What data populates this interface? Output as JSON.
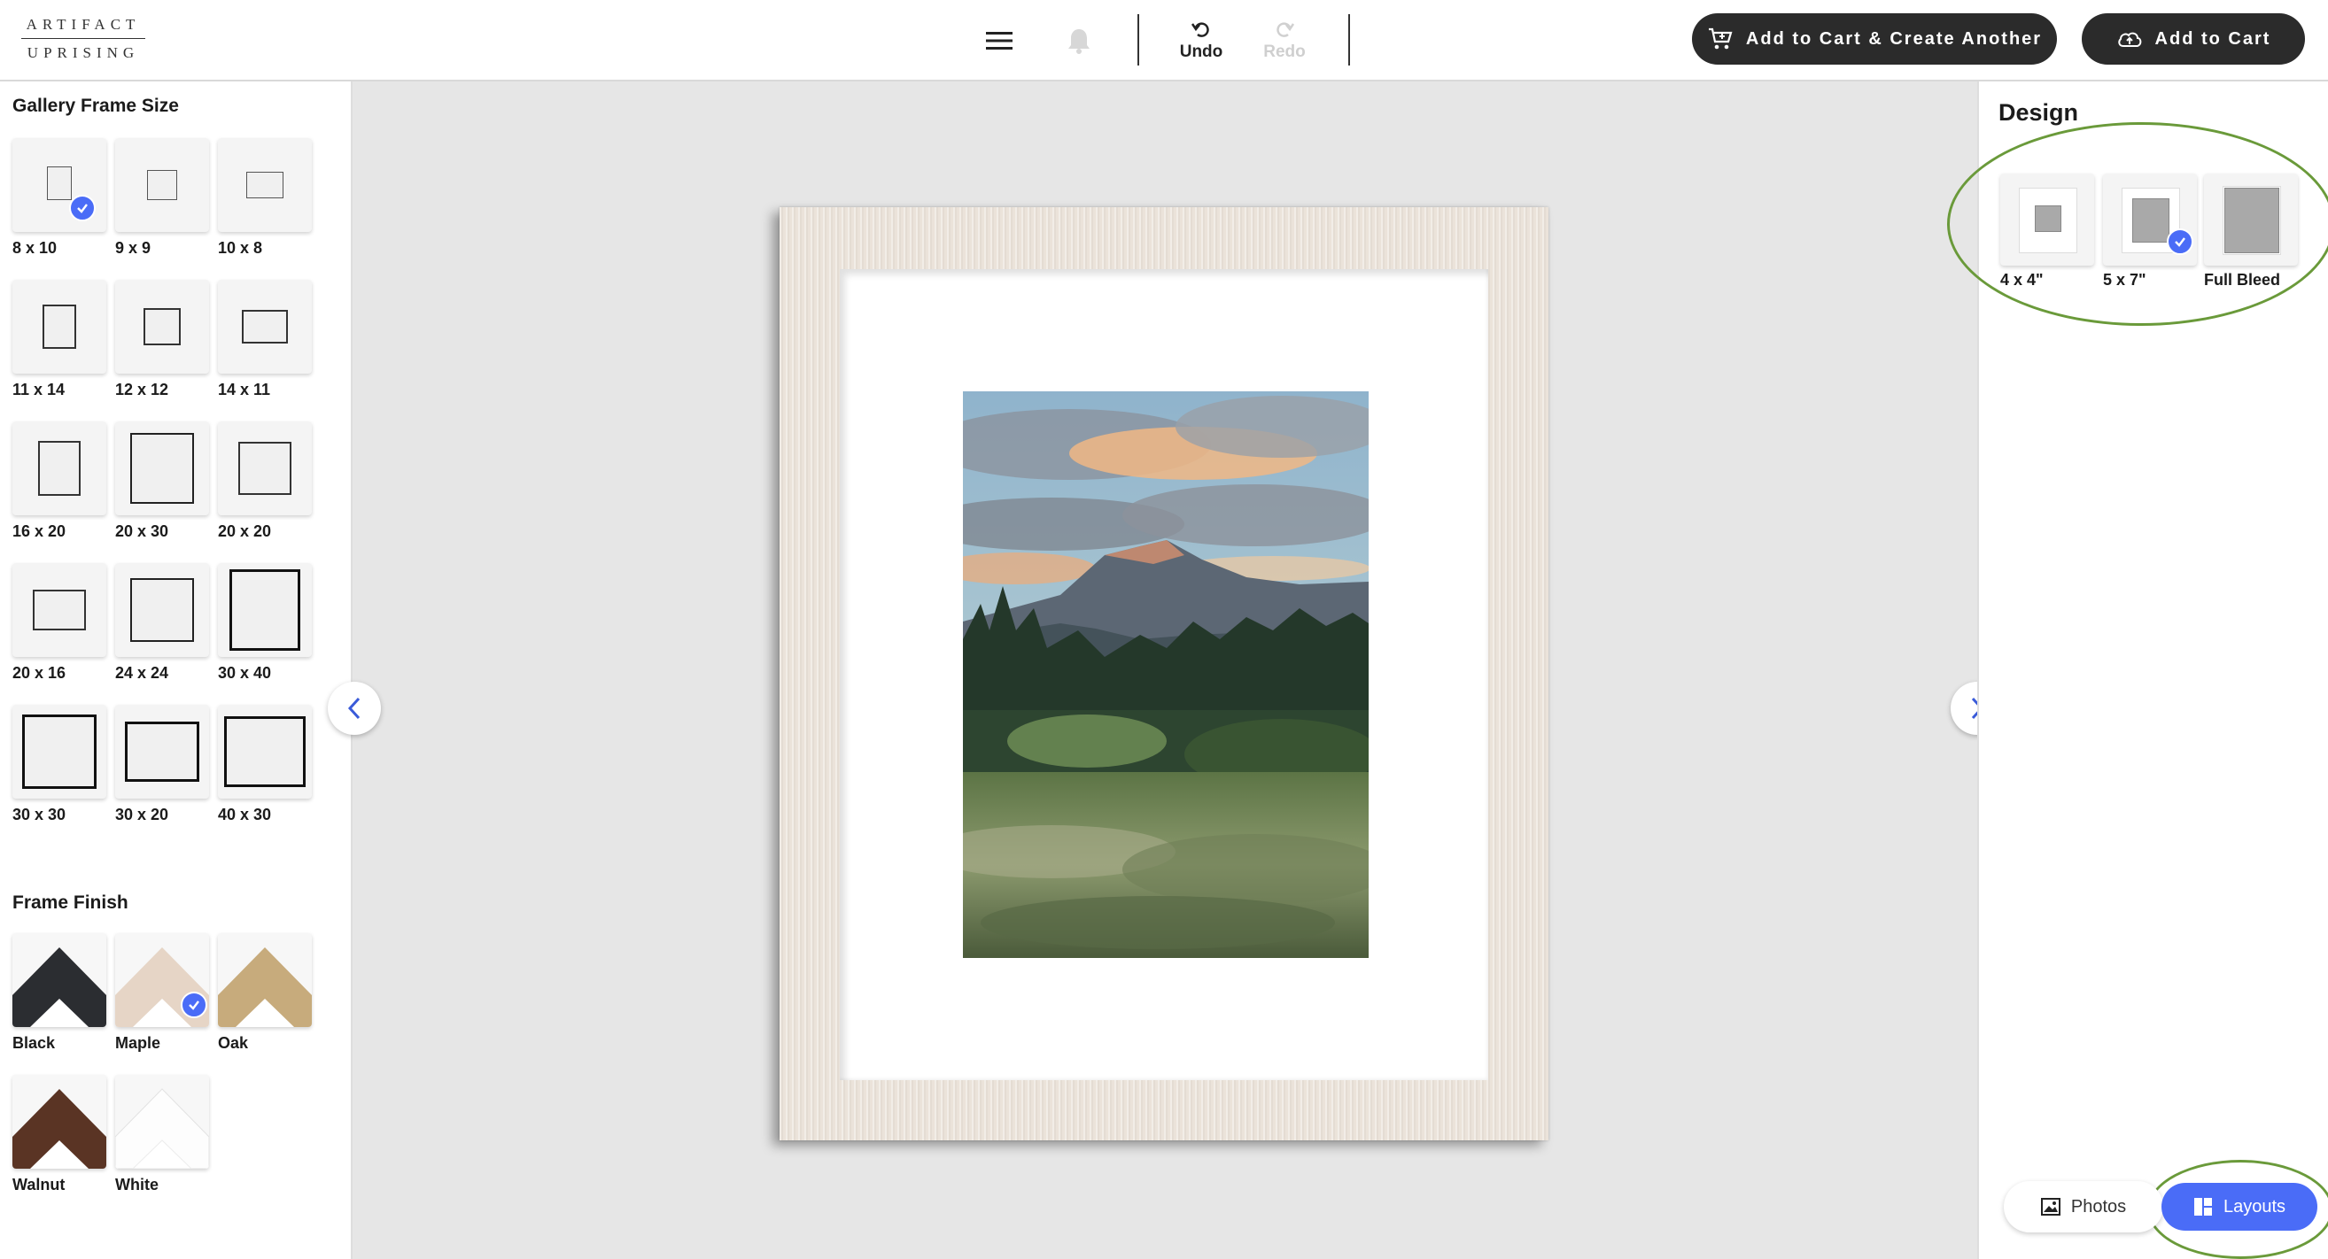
{
  "brand": {
    "line1": "ARTIFACT",
    "line2": "UPRISING"
  },
  "toolbar": {
    "menu_icon": "hamburger-icon",
    "notify_icon": "bell-icon",
    "undo_label": "Undo",
    "redo_label": "Redo",
    "add_create_label": "Add to Cart & Create Another",
    "add_cart_label": "Add to Cart"
  },
  "left": {
    "size_title": "Gallery Frame Size",
    "sizes": [
      {
        "label": "8 x 10",
        "selected": true
      },
      {
        "label": "9 x 9"
      },
      {
        "label": "10 x 8"
      },
      {
        "label": "11 x 14"
      },
      {
        "label": "12 x 12"
      },
      {
        "label": "14 x 11"
      },
      {
        "label": "16 x 20"
      },
      {
        "label": "20 x 30"
      },
      {
        "label": "20 x 20"
      },
      {
        "label": "20 x 16"
      },
      {
        "label": "24 x 24"
      },
      {
        "label": "30 x 40"
      },
      {
        "label": "30 x 30"
      },
      {
        "label": "30 x 20"
      },
      {
        "label": "40 x 30"
      }
    ],
    "finish_title": "Frame Finish",
    "finishes": [
      {
        "label": "Black",
        "color": "#2b2d31"
      },
      {
        "label": "Maple",
        "color": "#e6d5c6",
        "selected": true
      },
      {
        "label": "Oak",
        "color": "#c7ab7c"
      },
      {
        "label": "Walnut",
        "color": "#5a3424"
      },
      {
        "label": "White",
        "color": "#f6f6f6"
      }
    ]
  },
  "right": {
    "design_title": "Design",
    "layouts": [
      {
        "label": "4 x 4\""
      },
      {
        "label": "5 x 7\"",
        "selected": true
      },
      {
        "label": "Full Bleed"
      }
    ],
    "tab_photos": "Photos",
    "tab_layouts": "Layouts"
  },
  "colors": {
    "accent": "#4a6cf7",
    "dark_button": "#2b2b2b",
    "annotation": "#6a9a3a"
  }
}
